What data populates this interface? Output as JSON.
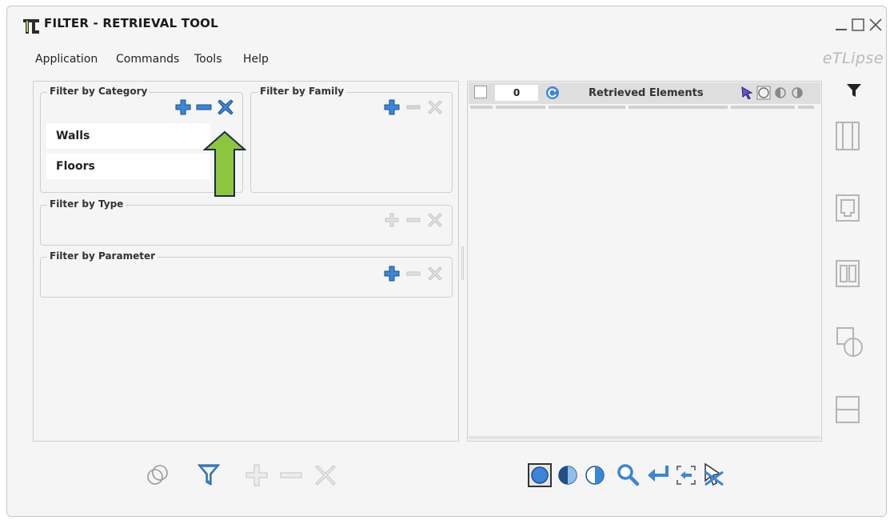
{
  "window": {
    "title": "FILTER - RETRIEVAL TOOL",
    "logo": "eTLipse",
    "controls": [
      "minimize-icon",
      "maximize-icon",
      "close-icon"
    ]
  },
  "menu": {
    "items": [
      "Application",
      "Commands",
      "Tools",
      "Help"
    ]
  },
  "filters": {
    "category": {
      "label": "Filter by Category",
      "items": [
        "Walls",
        "Floors"
      ]
    },
    "family": {
      "label": "Filter by Family"
    },
    "type": {
      "label": "Filter by Type"
    },
    "parameter": {
      "label": "Filter by Parameter"
    }
  },
  "results": {
    "count": "0",
    "title": "Retrieved Elements"
  },
  "colors": {
    "accent_blue": "#3a86d8",
    "disabled_gray": "#c4c4c4",
    "arrow_green": "#8cc63f"
  },
  "icons": {
    "left_bottom_toolbar": [
      "overlap-circles-icon",
      "filter-icon",
      "add-icon",
      "remove-icon",
      "clear-icon"
    ],
    "right_bottom_toolbar": [
      "select-all-icon",
      "half-select-icon",
      "invert-select-icon",
      "zoom-icon",
      "return-icon",
      "fit-icon",
      "isolate-icon"
    ],
    "side_toolbar": [
      "filter-funnel-icon",
      "wall-view-icon",
      "floor-view-icon",
      "column-view-icon",
      "shape-view-icon",
      "section-view-icon"
    ]
  }
}
